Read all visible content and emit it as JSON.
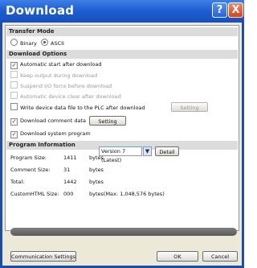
{
  "window": {
    "title": "Download",
    "help_glyph": "?",
    "close_glyph": "X"
  },
  "transfer_mode": {
    "header": "Transfer Mode",
    "options": [
      {
        "label": "Binary",
        "selected": false
      },
      {
        "label": "ASCII",
        "selected": true
      }
    ]
  },
  "download_options": {
    "header": "Download Options",
    "items": {
      "auto_start": {
        "label": "Automatic start after download",
        "checked": true,
        "enabled": true
      },
      "keep_output": {
        "label": "Keep output during download",
        "checked": false,
        "enabled": false
      },
      "suspend_io": {
        "label": "Suspend I/O force before download",
        "checked": false,
        "enabled": false
      },
      "auto_clear": {
        "label": "Automatic device clear after download",
        "checked": false,
        "enabled": false
      },
      "write_device": {
        "label": "Write device data file to the PLC after download",
        "checked": false,
        "enabled": true,
        "button": "Setting"
      },
      "download_comment": {
        "label": "Download comment data",
        "checked": true,
        "enabled": true,
        "button": "Setting"
      },
      "download_program": {
        "label": "Download system program",
        "checked": true,
        "enabled": true,
        "select_value": "Version 7 (Latest)",
        "button": "Detail"
      }
    }
  },
  "program_information": {
    "header": "Program Information",
    "rows": [
      {
        "label": "Program Size:",
        "value": "1411",
        "unit": "bytes"
      },
      {
        "label": "Comment Size:",
        "value": "31",
        "unit": "bytes"
      },
      {
        "label": "Total:",
        "value": "1442",
        "unit": "bytes"
      },
      {
        "label": "CustomHTML Size:",
        "value": "000",
        "unit": "bytes(Max: 1,048,576 bytes)"
      }
    ]
  },
  "footer": {
    "comm_settings": "Communication Settings",
    "ok": "OK",
    "cancel": "Cancel"
  },
  "colors": {
    "title_bar": "#1f5fd2",
    "section_bg": "#dcdcdc",
    "check_mark": "#2a5a2a"
  }
}
